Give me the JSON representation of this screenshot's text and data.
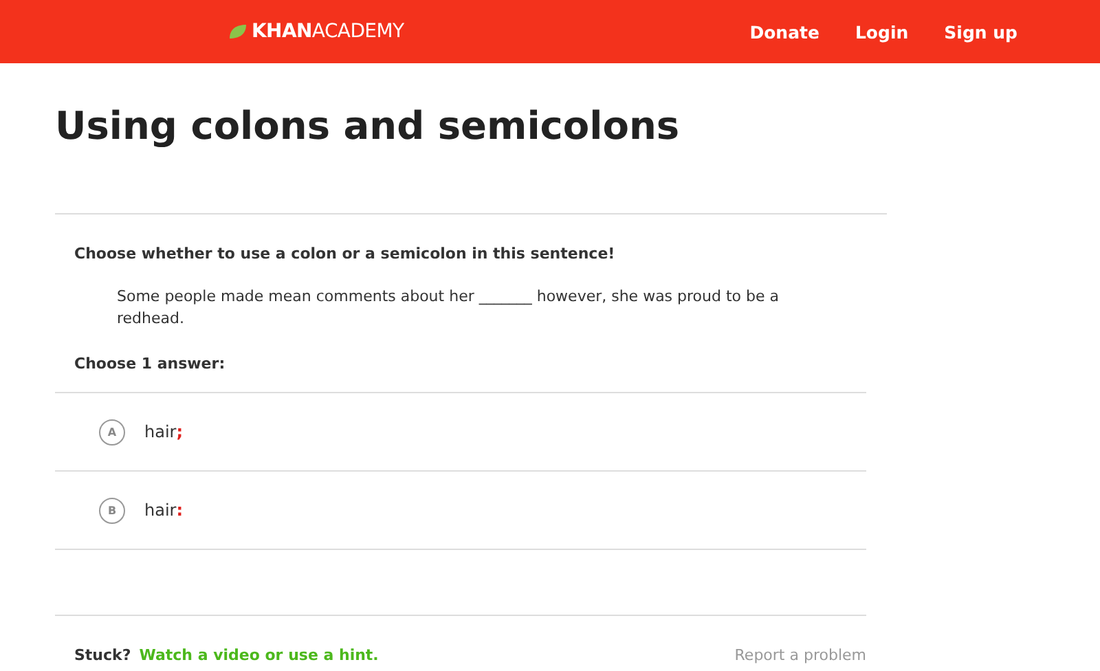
{
  "header": {
    "logo": "**KHAN**ACADEMY",
    "nav": [
      "Donate",
      "Login",
      "Sign up"
    ]
  },
  "title": "Using colons and semicolons",
  "question": "Choose whether to use a colon or a semicolon in this sentence!",
  "passage": "Some people made mean comments about her _______ however, she was proud to be a redhead.",
  "choose_label": "Choose 1 answer:",
  "choices": [
    {
      "letter": "A",
      "word": "hair",
      "mark": ";",
      "selected": false
    },
    {
      "letter": "B",
      "word": "hair",
      "mark": ":",
      "selected": false
    }
  ],
  "footer": {
    "stuck": "Stuck?",
    "hint_link": "Watch a video or use a hint.",
    "report": "Report a problem"
  }
}
